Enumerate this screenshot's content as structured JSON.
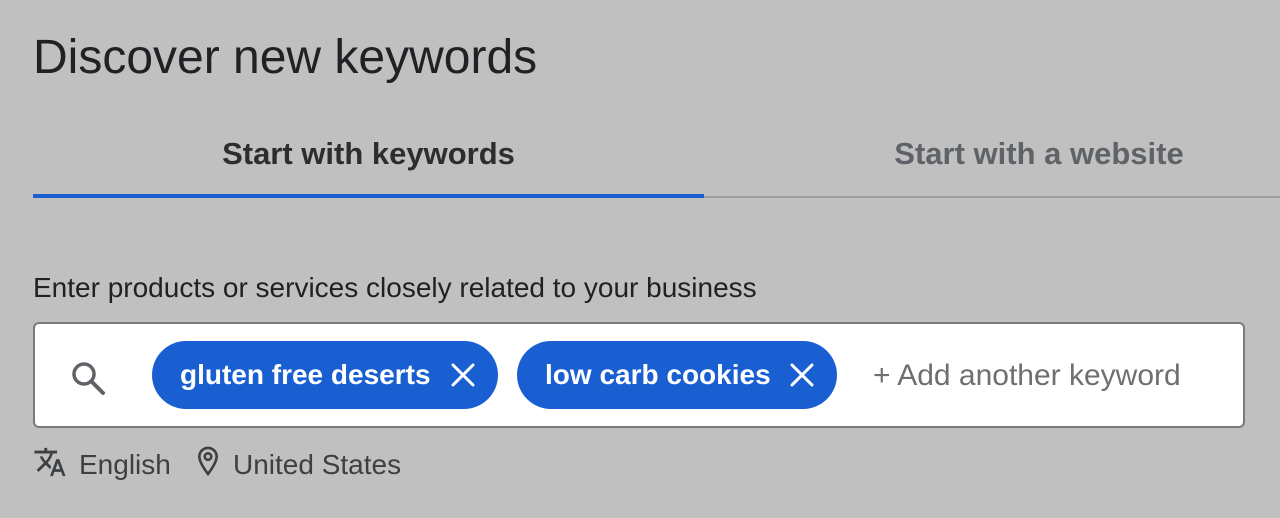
{
  "page": {
    "title": "Discover new keywords"
  },
  "tabs": [
    {
      "label": "Start with keywords",
      "selected": true
    },
    {
      "label": "Start with a website",
      "selected": false
    }
  ],
  "keyword_input": {
    "prompt": "Enter products or services closely related to your business",
    "search_icon": "search-icon",
    "chips": [
      {
        "label": "gluten free deserts",
        "remove_icon": "close-icon"
      },
      {
        "label": "low carb cookies",
        "remove_icon": "close-icon"
      }
    ],
    "add_placeholder": "+ Add another keyword"
  },
  "targeting": {
    "language": "English",
    "language_icon": "translate-icon",
    "location": "United States",
    "location_icon": "location-pin-icon"
  },
  "colors": {
    "accent": "#1a5fd1",
    "background": "#c0c0c0",
    "chip_text": "#ffffff"
  }
}
